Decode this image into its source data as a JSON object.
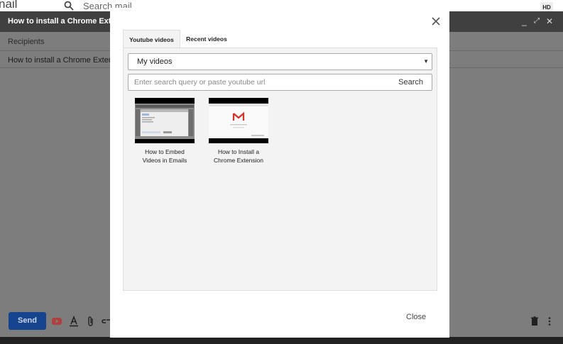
{
  "topbar": {
    "app_fragment": "nail",
    "search_placeholder": "Search mail",
    "hd_badge": "HD"
  },
  "compose": {
    "title": "How to install a Chrome Extension",
    "recipients_label": "Recipients",
    "subject": "How to install a Chrome Extension",
    "send_label": "Send",
    "icons": [
      "youtube-icon",
      "text-format-icon",
      "attach-icon",
      "link-icon",
      "trash-icon",
      "more-options-icon"
    ]
  },
  "modal": {
    "tabs": [
      {
        "label": "Youtube videos",
        "active": true
      },
      {
        "label": "Recent videos",
        "active": false
      }
    ],
    "select": {
      "value": "My videos"
    },
    "search": {
      "placeholder": "Enter search query or paste youtube url",
      "button_label": "Search"
    },
    "videos": [
      {
        "title_line1": "How to Embed",
        "title_line2": "Videos in Emails"
      },
      {
        "title_line1": "How to Install a",
        "title_line2": "Chrome Extension"
      }
    ],
    "close_label": "Close"
  },
  "colors": {
    "send_button": "#16448f",
    "overlay": "#7d7d7d",
    "compose_header": "#404040",
    "gmail_red": "#d93025",
    "youtube_red": "#b04040"
  }
}
